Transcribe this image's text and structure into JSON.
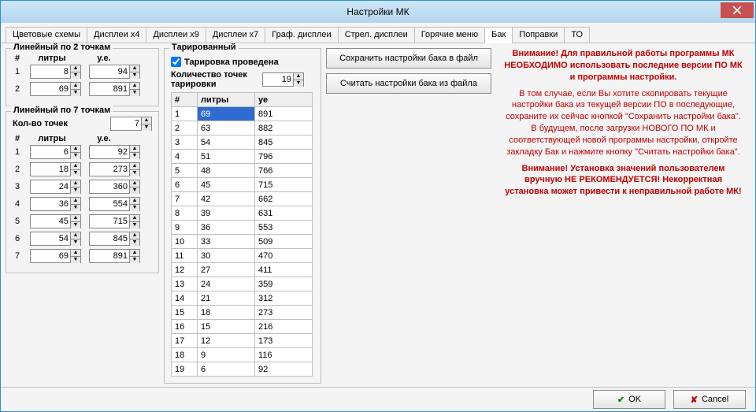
{
  "window_title": "Настройки МК",
  "tabs": [
    "Цветовые схемы",
    "Дисплеи x4",
    "Дисплеи x9",
    "Дисплеи x7",
    "Граф. дисплеи",
    "Стрел. дисплеи",
    "Горячие меню",
    "Бак",
    "Поправки",
    "ТО"
  ],
  "active_tab_index": 7,
  "linear2": {
    "title": "Линейный по 2 точкам",
    "headers": [
      "#",
      "литры",
      "у.е."
    ],
    "rows": [
      {
        "idx": "1",
        "liters": "8",
        "ue": "94"
      },
      {
        "idx": "2",
        "liters": "69",
        "ue": "891"
      }
    ]
  },
  "linear7": {
    "title": "Линейный по 7 точкам",
    "count_label": "Кол-во точек",
    "count_value": "7",
    "headers": [
      "#",
      "литры",
      "у.е."
    ],
    "rows": [
      {
        "idx": "1",
        "liters": "6",
        "ue": "92"
      },
      {
        "idx": "2",
        "liters": "18",
        "ue": "273"
      },
      {
        "idx": "3",
        "liters": "24",
        "ue": "360"
      },
      {
        "idx": "4",
        "liters": "36",
        "ue": "554"
      },
      {
        "idx": "5",
        "liters": "45",
        "ue": "715"
      },
      {
        "idx": "6",
        "liters": "54",
        "ue": "845"
      },
      {
        "idx": "7",
        "liters": "69",
        "ue": "891"
      }
    ]
  },
  "tarir": {
    "title": "Тарированный",
    "done_label": "Тарировка проведена",
    "done_checked": true,
    "count_label": "Количество точек тарировки",
    "count_value": "19",
    "headers": [
      "#",
      "литры",
      "уе"
    ],
    "rows": [
      {
        "idx": "1",
        "liters": "69",
        "ue": "891"
      },
      {
        "idx": "2",
        "liters": "63",
        "ue": "882"
      },
      {
        "idx": "3",
        "liters": "54",
        "ue": "845"
      },
      {
        "idx": "4",
        "liters": "51",
        "ue": "796"
      },
      {
        "idx": "5",
        "liters": "48",
        "ue": "766"
      },
      {
        "idx": "6",
        "liters": "45",
        "ue": "715"
      },
      {
        "idx": "7",
        "liters": "42",
        "ue": "662"
      },
      {
        "idx": "8",
        "liters": "39",
        "ue": "631"
      },
      {
        "idx": "9",
        "liters": "36",
        "ue": "553"
      },
      {
        "idx": "10",
        "liters": "33",
        "ue": "509"
      },
      {
        "idx": "11",
        "liters": "30",
        "ue": "470"
      },
      {
        "idx": "12",
        "liters": "27",
        "ue": "411"
      },
      {
        "idx": "13",
        "liters": "24",
        "ue": "359"
      },
      {
        "idx": "14",
        "liters": "21",
        "ue": "312"
      },
      {
        "idx": "15",
        "liters": "18",
        "ue": "273"
      },
      {
        "idx": "16",
        "liters": "15",
        "ue": "216"
      },
      {
        "idx": "17",
        "liters": "12",
        "ue": "173"
      },
      {
        "idx": "18",
        "liters": "9",
        "ue": "116"
      },
      {
        "idx": "19",
        "liters": "6",
        "ue": "92"
      }
    ]
  },
  "buttons": {
    "save": "Сохранить настройки бака в файл",
    "load": "Считать настройки бака из файла"
  },
  "warning1": "Внимание! Для правильной работы программы МК НЕОБХОДИМО использовать последние версии ПО МК и программы настройки.",
  "info1": "В том случае, если Вы хотите скопировать текущие настройки бака из текущей версии ПО в последующие, сохраните их сейчас кнопкой \"Сохранить настройки бака\". В будущем, после загрузки НОВОГО ПО МК и соответствующей новой программы настройки, откройте закладку Бак и нажмите кнопку \"Считать настройки бака\".",
  "warning2": "Внимание! Установка значений пользователем вручную НЕ РЕКОМЕНДУЕТСЯ! Некорректная установка может привести к неправильной работе МК!",
  "footer": {
    "ok": "OK",
    "cancel": "Cancel"
  }
}
